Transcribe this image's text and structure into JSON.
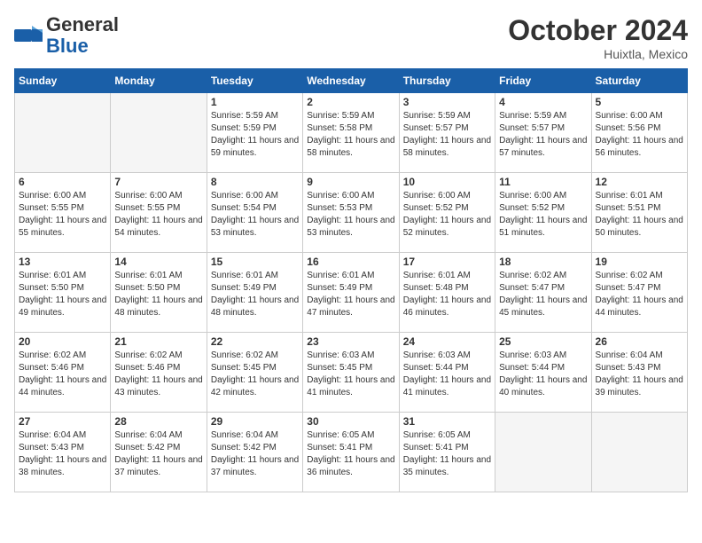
{
  "header": {
    "logo_general": "General",
    "logo_blue": "Blue",
    "month_title": "October 2024",
    "location": "Huixtla, Mexico"
  },
  "weekdays": [
    "Sunday",
    "Monday",
    "Tuesday",
    "Wednesday",
    "Thursday",
    "Friday",
    "Saturday"
  ],
  "weeks": [
    [
      {
        "day": "",
        "info": ""
      },
      {
        "day": "",
        "info": ""
      },
      {
        "day": "1",
        "info": "Sunrise: 5:59 AM\nSunset: 5:59 PM\nDaylight: 11 hours and 59 minutes."
      },
      {
        "day": "2",
        "info": "Sunrise: 5:59 AM\nSunset: 5:58 PM\nDaylight: 11 hours and 58 minutes."
      },
      {
        "day": "3",
        "info": "Sunrise: 5:59 AM\nSunset: 5:57 PM\nDaylight: 11 hours and 58 minutes."
      },
      {
        "day": "4",
        "info": "Sunrise: 5:59 AM\nSunset: 5:57 PM\nDaylight: 11 hours and 57 minutes."
      },
      {
        "day": "5",
        "info": "Sunrise: 6:00 AM\nSunset: 5:56 PM\nDaylight: 11 hours and 56 minutes."
      }
    ],
    [
      {
        "day": "6",
        "info": "Sunrise: 6:00 AM\nSunset: 5:55 PM\nDaylight: 11 hours and 55 minutes."
      },
      {
        "day": "7",
        "info": "Sunrise: 6:00 AM\nSunset: 5:55 PM\nDaylight: 11 hours and 54 minutes."
      },
      {
        "day": "8",
        "info": "Sunrise: 6:00 AM\nSunset: 5:54 PM\nDaylight: 11 hours and 53 minutes."
      },
      {
        "day": "9",
        "info": "Sunrise: 6:00 AM\nSunset: 5:53 PM\nDaylight: 11 hours and 53 minutes."
      },
      {
        "day": "10",
        "info": "Sunrise: 6:00 AM\nSunset: 5:52 PM\nDaylight: 11 hours and 52 minutes."
      },
      {
        "day": "11",
        "info": "Sunrise: 6:00 AM\nSunset: 5:52 PM\nDaylight: 11 hours and 51 minutes."
      },
      {
        "day": "12",
        "info": "Sunrise: 6:01 AM\nSunset: 5:51 PM\nDaylight: 11 hours and 50 minutes."
      }
    ],
    [
      {
        "day": "13",
        "info": "Sunrise: 6:01 AM\nSunset: 5:50 PM\nDaylight: 11 hours and 49 minutes."
      },
      {
        "day": "14",
        "info": "Sunrise: 6:01 AM\nSunset: 5:50 PM\nDaylight: 11 hours and 48 minutes."
      },
      {
        "day": "15",
        "info": "Sunrise: 6:01 AM\nSunset: 5:49 PM\nDaylight: 11 hours and 48 minutes."
      },
      {
        "day": "16",
        "info": "Sunrise: 6:01 AM\nSunset: 5:49 PM\nDaylight: 11 hours and 47 minutes."
      },
      {
        "day": "17",
        "info": "Sunrise: 6:01 AM\nSunset: 5:48 PM\nDaylight: 11 hours and 46 minutes."
      },
      {
        "day": "18",
        "info": "Sunrise: 6:02 AM\nSunset: 5:47 PM\nDaylight: 11 hours and 45 minutes."
      },
      {
        "day": "19",
        "info": "Sunrise: 6:02 AM\nSunset: 5:47 PM\nDaylight: 11 hours and 44 minutes."
      }
    ],
    [
      {
        "day": "20",
        "info": "Sunrise: 6:02 AM\nSunset: 5:46 PM\nDaylight: 11 hours and 44 minutes."
      },
      {
        "day": "21",
        "info": "Sunrise: 6:02 AM\nSunset: 5:46 PM\nDaylight: 11 hours and 43 minutes."
      },
      {
        "day": "22",
        "info": "Sunrise: 6:02 AM\nSunset: 5:45 PM\nDaylight: 11 hours and 42 minutes."
      },
      {
        "day": "23",
        "info": "Sunrise: 6:03 AM\nSunset: 5:45 PM\nDaylight: 11 hours and 41 minutes."
      },
      {
        "day": "24",
        "info": "Sunrise: 6:03 AM\nSunset: 5:44 PM\nDaylight: 11 hours and 41 minutes."
      },
      {
        "day": "25",
        "info": "Sunrise: 6:03 AM\nSunset: 5:44 PM\nDaylight: 11 hours and 40 minutes."
      },
      {
        "day": "26",
        "info": "Sunrise: 6:04 AM\nSunset: 5:43 PM\nDaylight: 11 hours and 39 minutes."
      }
    ],
    [
      {
        "day": "27",
        "info": "Sunrise: 6:04 AM\nSunset: 5:43 PM\nDaylight: 11 hours and 38 minutes."
      },
      {
        "day": "28",
        "info": "Sunrise: 6:04 AM\nSunset: 5:42 PM\nDaylight: 11 hours and 37 minutes."
      },
      {
        "day": "29",
        "info": "Sunrise: 6:04 AM\nSunset: 5:42 PM\nDaylight: 11 hours and 37 minutes."
      },
      {
        "day": "30",
        "info": "Sunrise: 6:05 AM\nSunset: 5:41 PM\nDaylight: 11 hours and 36 minutes."
      },
      {
        "day": "31",
        "info": "Sunrise: 6:05 AM\nSunset: 5:41 PM\nDaylight: 11 hours and 35 minutes."
      },
      {
        "day": "",
        "info": ""
      },
      {
        "day": "",
        "info": ""
      }
    ]
  ]
}
